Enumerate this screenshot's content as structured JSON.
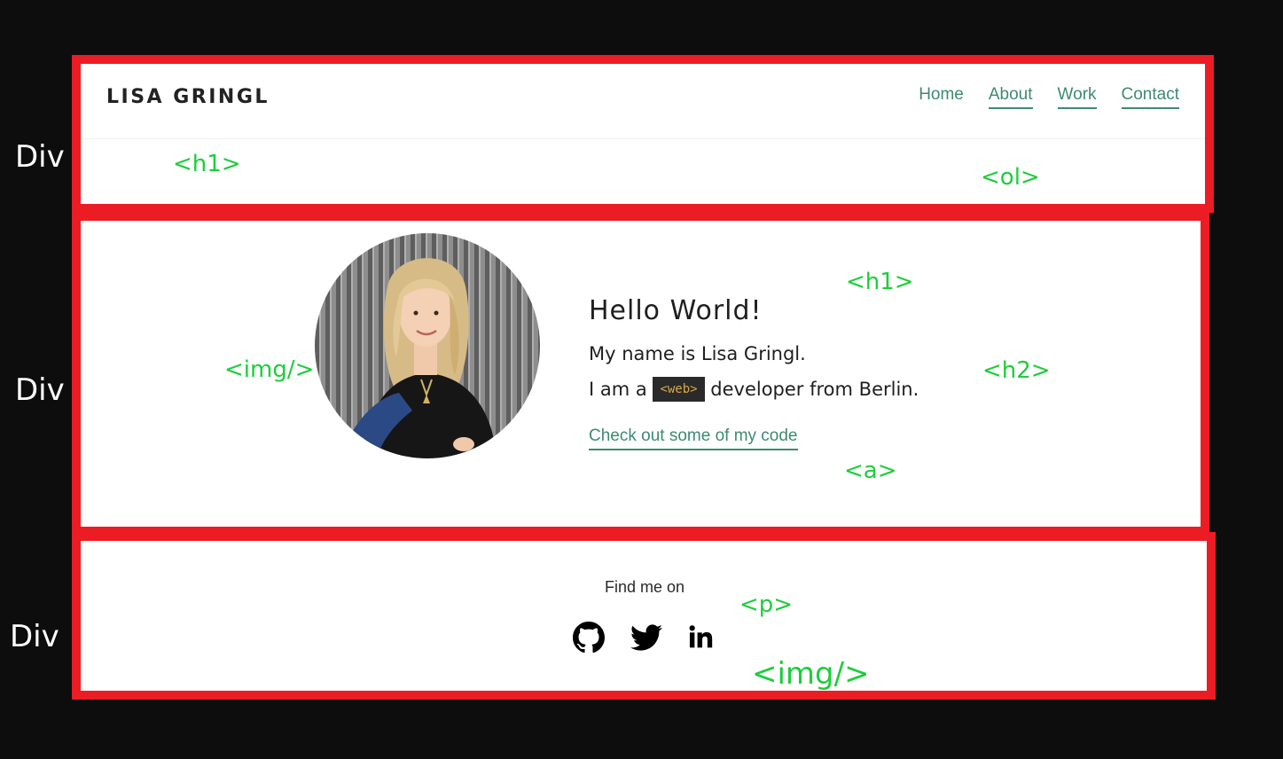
{
  "annotations": {
    "div_label": "Div",
    "tags": {
      "header_h1": "<h1>",
      "header_ol": "<ol>",
      "hero_h1": "<h1>",
      "hero_img": "<img/>",
      "hero_h2": "<h2>",
      "hero_a": "<a>",
      "footer_p": "<p>",
      "footer_img": "<img/>"
    },
    "box_color": "#ec1c24",
    "tag_color": "#1ecd3c"
  },
  "header": {
    "title": "LISA GRINGL",
    "nav": [
      "Home",
      "About",
      "Work",
      "Contact"
    ]
  },
  "hero": {
    "greeting": "Hello World!",
    "line1": "My name is Lisa Gringl.",
    "line2_before": "I am a",
    "badge": "<web>",
    "line2_after": "developer from Berlin.",
    "link": "Check out some of my code",
    "accent_color": "#3e8a72"
  },
  "footer": {
    "find_text": "Find me on",
    "icons": [
      "github-icon",
      "twitter-icon",
      "linkedin-icon"
    ]
  }
}
